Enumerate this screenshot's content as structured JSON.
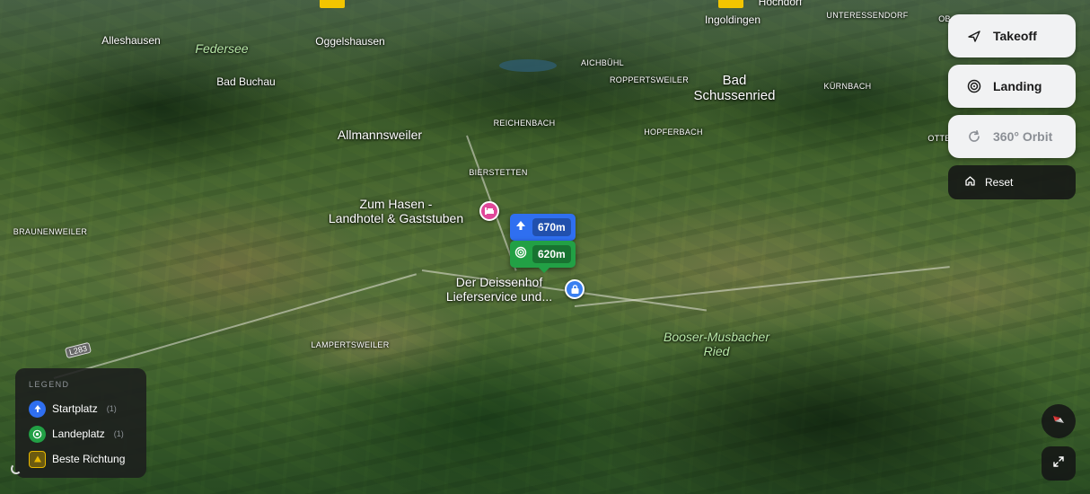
{
  "map": {
    "places": [
      {
        "id": "alleshausen",
        "label": "Alleshausen",
        "kind": "town"
      },
      {
        "id": "federsee",
        "label": "Federsee",
        "kind": "nature"
      },
      {
        "id": "oggelshausen",
        "label": "Oggelshausen",
        "kind": "town"
      },
      {
        "id": "bad-buchau",
        "label": "Bad Buchau",
        "kind": "town"
      },
      {
        "id": "aichbuhl",
        "label": "AICHBÜHL",
        "kind": "small"
      },
      {
        "id": "ingoldingen",
        "label": "Ingoldingen",
        "kind": "town"
      },
      {
        "id": "hochdorf",
        "label": "Hochdorf",
        "kind": "town"
      },
      {
        "id": "unteressendorf",
        "label": "UNTERESSENDORF",
        "kind": "small"
      },
      {
        "id": "ob",
        "label": "OB",
        "kind": "small"
      },
      {
        "id": "roppertsweiler",
        "label": "ROPPERTSWEILER",
        "kind": "small"
      },
      {
        "id": "bad-schussenried",
        "label": "Bad\nSchussenried",
        "kind": "city"
      },
      {
        "id": "kurnbach",
        "label": "KÜRNBACH",
        "kind": "small"
      },
      {
        "id": "reichenbach",
        "label": "REICHENBACH",
        "kind": "small"
      },
      {
        "id": "hopferbach",
        "label": "HOPFERBACH",
        "kind": "small"
      },
      {
        "id": "otte",
        "label": "OTTE",
        "kind": "small"
      },
      {
        "id": "allmannsweiler",
        "label": "Allmannsweiler",
        "kind": "big"
      },
      {
        "id": "bierstetten",
        "label": "BIERSTETTEN",
        "kind": "small"
      },
      {
        "id": "braunenweiler",
        "label": "BRAUNENWEILER",
        "kind": "small"
      },
      {
        "id": "lampertsweiler",
        "label": "LAMPERTSWEILER",
        "kind": "small"
      },
      {
        "id": "booser",
        "label": "Booser-Musbacher\nRied",
        "kind": "nature"
      }
    ],
    "pois": [
      {
        "id": "zum-hasen",
        "label": "Zum Hasen -\nLandhotel & Gaststuben",
        "icon": "hotel-icon"
      },
      {
        "id": "deissenhof",
        "label": "Der Deissenhof\nLieferservice und...",
        "icon": "shopping-bag-icon"
      }
    ],
    "road_label": "L283",
    "markers": {
      "start": {
        "altitude": "670m",
        "icon": "arrow-up-icon",
        "color": "#2f6ff0"
      },
      "landing": {
        "altitude": "620m",
        "icon": "target-icon",
        "color": "#22a045"
      }
    }
  },
  "controls": {
    "takeoff": {
      "label": "Takeoff",
      "icon": "plane-icon"
    },
    "landing": {
      "label": "Landing",
      "icon": "target-icon"
    },
    "orbit": {
      "label": "360° Orbit",
      "icon": "rotate-icon"
    },
    "reset": {
      "label": "Reset",
      "icon": "home-icon"
    },
    "compass": {
      "icon": "compass-icon"
    },
    "fullscreen": {
      "icon": "expand-icon"
    }
  },
  "legend": {
    "title": "LEGEND",
    "items": [
      {
        "label": "Startplatz",
        "count": "(1)",
        "icon": "arrow-up-icon",
        "color": "#2f6ff0"
      },
      {
        "label": "Landeplatz",
        "count": "(1)",
        "icon": "target-icon",
        "color": "#22a045"
      },
      {
        "label": "Beste Richtung",
        "count": "",
        "icon": "triangle-icon",
        "color": "#e8b800"
      }
    ]
  }
}
